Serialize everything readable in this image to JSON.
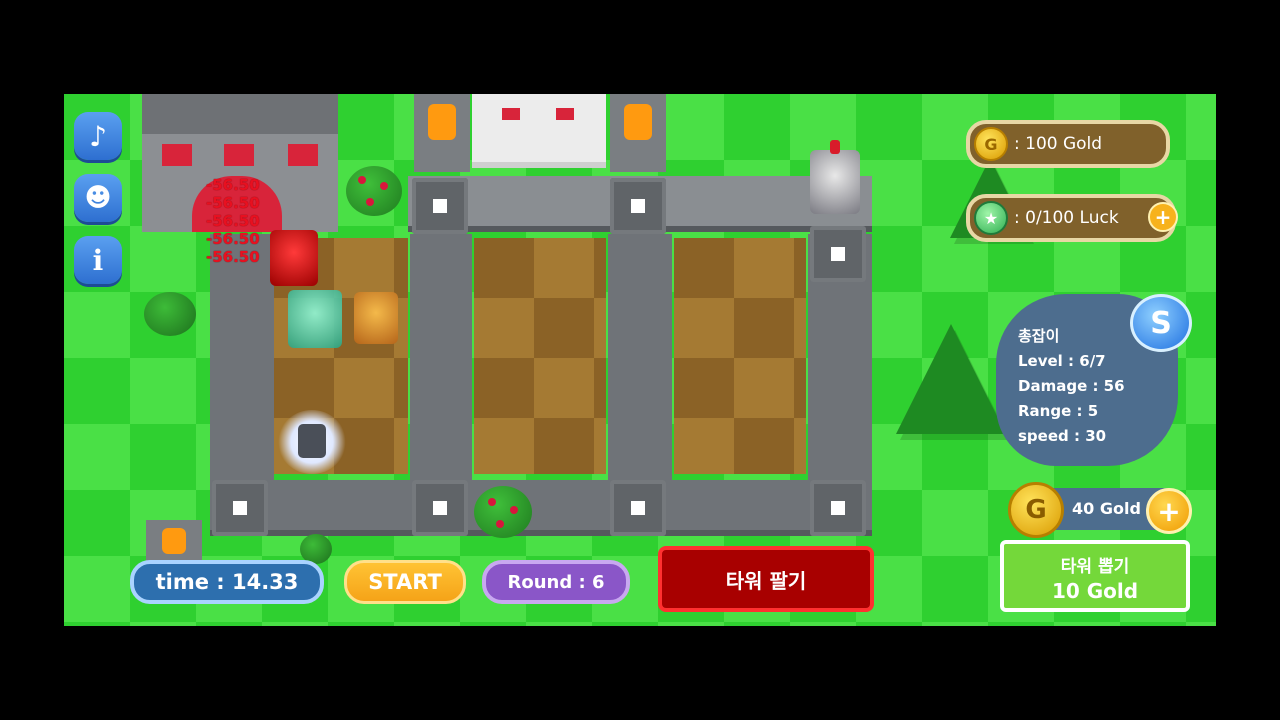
{
  "hud": {
    "time": "time : 14.33",
    "start_label": "START",
    "round": "Round : 6",
    "sell_tower_label": "타워 팔기",
    "draw_tower_label": "타워 뽑기",
    "draw_tower_cost": "10 Gold"
  },
  "resources": {
    "gold": ": 100 Gold",
    "luck": ": 0/100 Luck",
    "luck_plus": "+",
    "coin_glyph": "G",
    "upgrade_gold": "40 Gold",
    "upgrade_plus": "+"
  },
  "tower_info": {
    "badge": "S",
    "name": "총잡이",
    "level": "Level : 6/7",
    "damage": "Damage : 56",
    "range": "Range : 5",
    "speed": "speed : 30"
  },
  "side_buttons": [
    {
      "icon": "music-note-icon",
      "glyph": "♪"
    },
    {
      "icon": "ghost-icon",
      "glyph": "☻"
    },
    {
      "icon": "info-icon",
      "glyph": "i"
    }
  ],
  "damage_numbers": [
    "-56.50",
    "-56.50",
    "-56.50",
    "-56.50",
    "-56.50"
  ],
  "colors": {
    "grass": "#2fd030",
    "sell_button": "#a80000",
    "draw_button": "#74d83a",
    "start_button": "#f5a318",
    "round_pill": "#8a56c8",
    "time_pill": "#2d6fae",
    "info_panel": "#4d6d8e"
  }
}
